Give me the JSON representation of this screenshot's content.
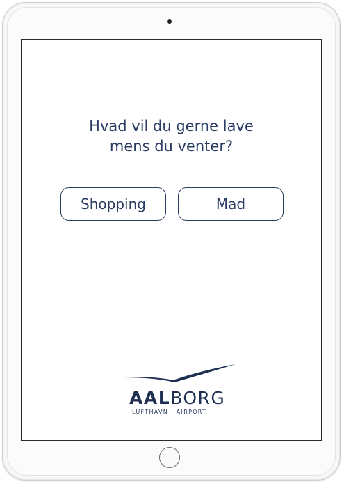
{
  "question": {
    "line1": "Hvad vil du gerne lave",
    "line2": "mens du venter?"
  },
  "choices": [
    {
      "label": "Shopping"
    },
    {
      "label": "Mad"
    }
  ],
  "logo": {
    "bold_text": "AAL",
    "light_text": "BORG",
    "tagline": "LUFTHAVN | AIRPORT"
  },
  "colors": {
    "brand_navy": "#2b3d63",
    "logo_navy": "#1f2f52",
    "screen_bg": "#ffffff"
  },
  "icons": {
    "camera": "camera-icon",
    "home_button": "home-button-icon",
    "logo_swoosh": "swoosh-icon"
  }
}
